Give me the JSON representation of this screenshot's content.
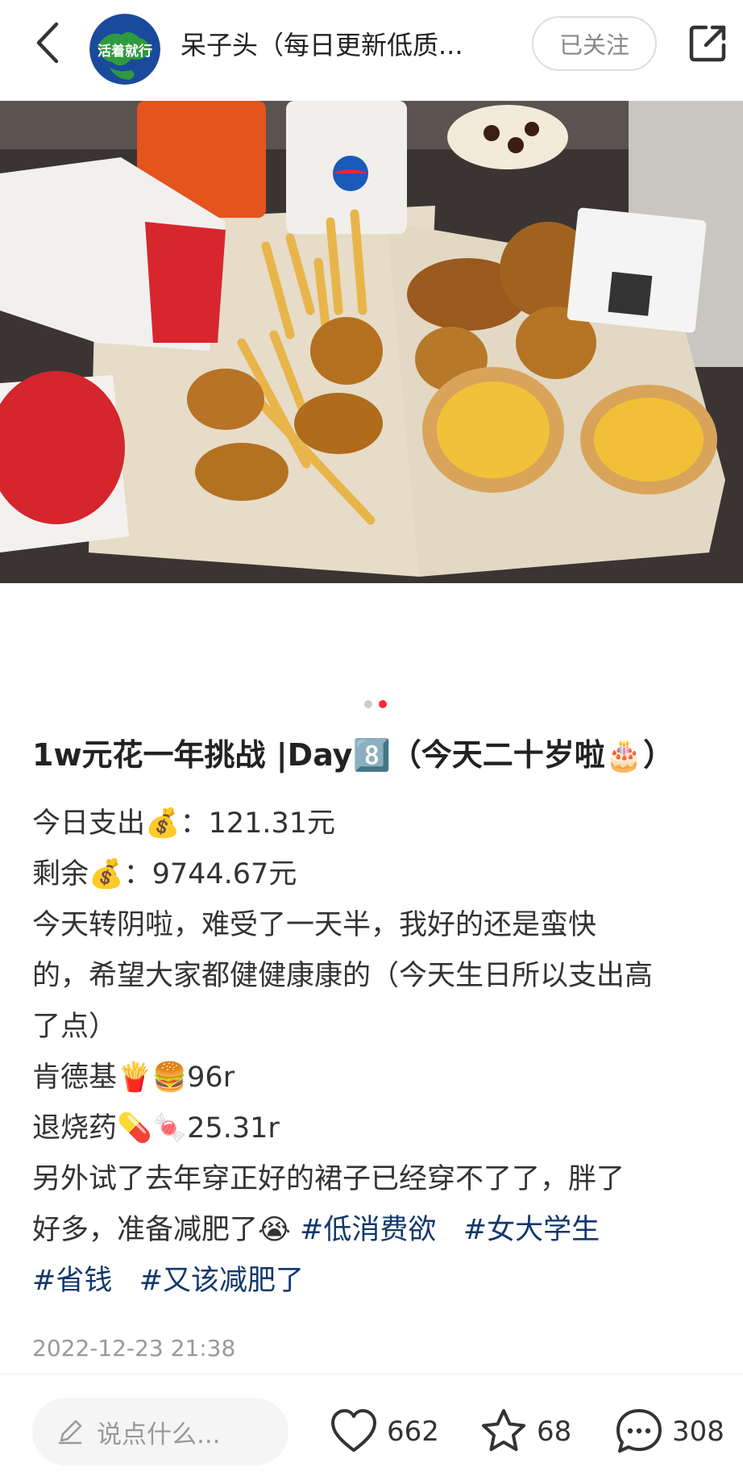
{
  "header": {
    "avatar_text": "活着就行",
    "author_name": "呆子头（每日更新低质...",
    "follow_label": "已关注"
  },
  "carousel": {
    "current": 2,
    "total": 2
  },
  "post": {
    "title": "1w元花一年挑战 |Day8️⃣（今天二十岁啦🎂）",
    "body_lines": [
      "今日支出💰：121.31元",
      "剩余💰：9744.67元",
      "今天转阴啦，难受了一天半，我好的还是蛮快",
      "的，希望大家都健健康康的（今天生日所以支出高",
      "了点）",
      "肯德基🍟🍔96r",
      "退烧药💊🍬25.31r",
      "另外试了去年穿正好的裙子已经穿不了了，胖了",
      "好多，准备减肥了😭"
    ],
    "tags": [
      "#低消费欲",
      "#女大学生",
      "#省钱",
      "#又该减肥了"
    ],
    "date": "2022-12-23 21:38"
  },
  "bottom_bar": {
    "comment_placeholder": "说点什么...",
    "likes": "662",
    "collects": "68",
    "comments": "308"
  },
  "colors": {
    "accent": "#ff2442",
    "tag": "#13386c"
  },
  "icons": [
    "back-icon",
    "share-icon",
    "pen-icon",
    "heart-icon",
    "star-icon",
    "comment-icon"
  ]
}
